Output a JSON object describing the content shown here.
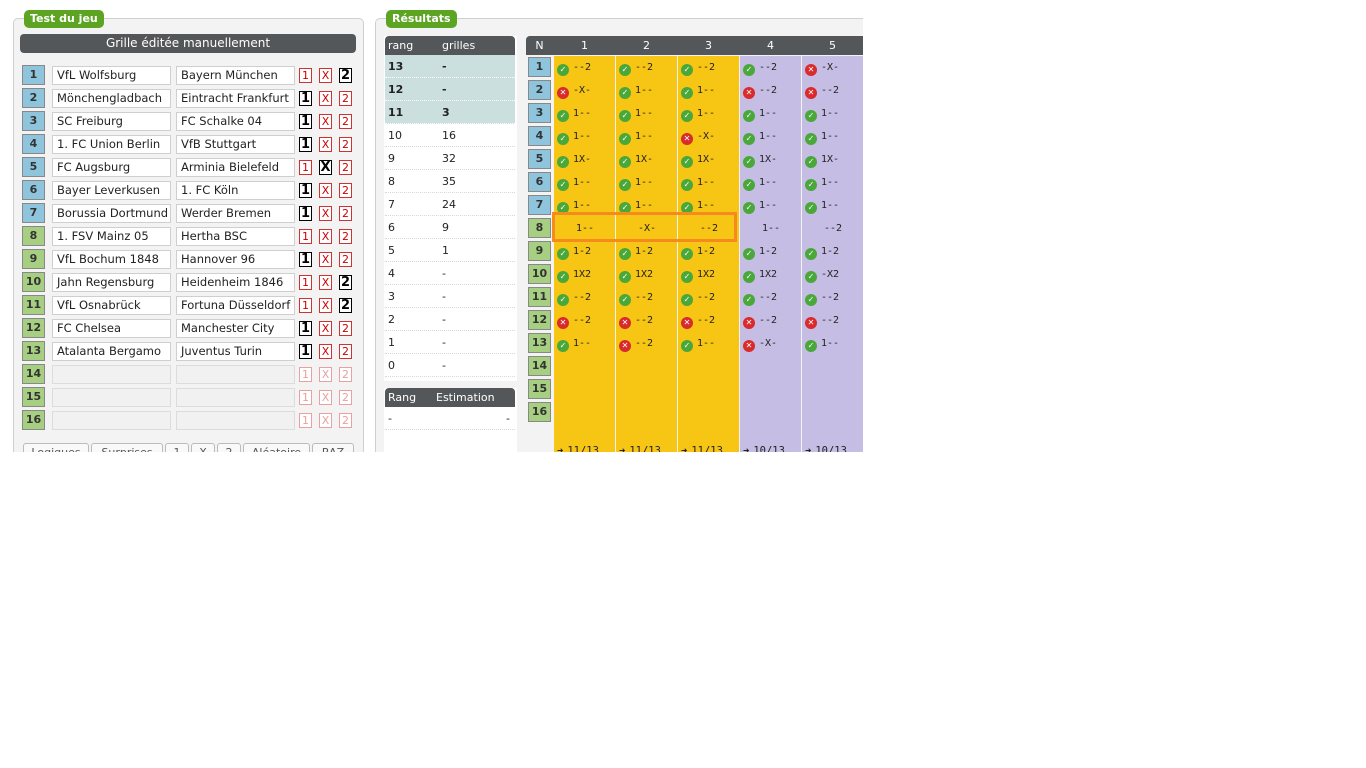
{
  "left_panel": {
    "title": "Test du jeu",
    "grid_title": "Grille éditée manuellement",
    "matches": [
      {
        "num": "1",
        "home": "VfL Wolfsburg",
        "away": "Bayern München",
        "pick": "2"
      },
      {
        "num": "2",
        "home": "Mönchengladbach",
        "away": "Eintracht Frankfurt",
        "pick": "1"
      },
      {
        "num": "3",
        "home": "SC Freiburg",
        "away": "FC Schalke 04",
        "pick": "1"
      },
      {
        "num": "4",
        "home": "1. FC Union Berlin",
        "away": "VfB Stuttgart",
        "pick": "1"
      },
      {
        "num": "5",
        "home": "FC Augsburg",
        "away": "Arminia Bielefeld",
        "pick": "X"
      },
      {
        "num": "6",
        "home": "Bayer Leverkusen",
        "away": "1. FC Köln",
        "pick": "1"
      },
      {
        "num": "7",
        "home": "Borussia Dortmund",
        "away": "Werder Bremen",
        "pick": "1"
      },
      {
        "num": "8",
        "home": "1. FSV Mainz 05",
        "away": "Hertha BSC",
        "pick": ""
      },
      {
        "num": "9",
        "home": "VfL Bochum 1848",
        "away": "Hannover 96",
        "pick": "1"
      },
      {
        "num": "10",
        "home": "Jahn Regensburg",
        "away": "Heidenheim 1846",
        "pick": "2"
      },
      {
        "num": "11",
        "home": "VfL Osnabrück",
        "away": "Fortuna Düsseldorf",
        "pick": "2"
      },
      {
        "num": "12",
        "home": "FC Chelsea",
        "away": "Manchester City",
        "pick": "1"
      },
      {
        "num": "13",
        "home": "Atalanta Bergamo",
        "away": "Juventus Turin",
        "pick": "1"
      },
      {
        "num": "14",
        "home": "",
        "away": "",
        "pick": ""
      },
      {
        "num": "15",
        "home": "",
        "away": "",
        "pick": ""
      },
      {
        "num": "16",
        "home": "",
        "away": "",
        "pick": ""
      }
    ],
    "pick_labels": [
      "1",
      "X",
      "2"
    ],
    "bottom_buttons": [
      "Logiques",
      "Surprises",
      "1",
      "X",
      "2",
      "Aléatoire",
      "RAZ"
    ]
  },
  "right_panel": {
    "title": "Résultats",
    "rank_table": {
      "headers": [
        "rang",
        "grilles"
      ],
      "rows": [
        {
          "rang": "13",
          "grilles": "-",
          "highlight": true
        },
        {
          "rang": "12",
          "grilles": "-",
          "highlight": true
        },
        {
          "rang": "11",
          "grilles": "3",
          "highlight": true
        },
        {
          "rang": "10",
          "grilles": "16",
          "highlight": false
        },
        {
          "rang": "9",
          "grilles": "32",
          "highlight": false
        },
        {
          "rang": "8",
          "grilles": "35",
          "highlight": false
        },
        {
          "rang": "7",
          "grilles": "24",
          "highlight": false
        },
        {
          "rang": "6",
          "grilles": "9",
          "highlight": false
        },
        {
          "rang": "5",
          "grilles": "1",
          "highlight": false
        },
        {
          "rang": "4",
          "grilles": "-",
          "highlight": false
        },
        {
          "rang": "3",
          "grilles": "-",
          "highlight": false
        },
        {
          "rang": "2",
          "grilles": "-",
          "highlight": false
        },
        {
          "rang": "1",
          "grilles": "-",
          "highlight": false
        },
        {
          "rang": "0",
          "grilles": "-",
          "highlight": false
        }
      ]
    },
    "estimation_table": {
      "headers": [
        "Rang",
        "Estimation"
      ],
      "rows": [
        {
          "rang": "-",
          "estimation": "-"
        }
      ]
    },
    "results_grid": {
      "header_n": "N",
      "columns": [
        "1",
        "2",
        "3",
        "4",
        "5"
      ],
      "column_colors": [
        "#f7c514",
        "#f7c514",
        "#f7c514",
        "#c5bde4",
        "#c5bde4"
      ],
      "row_numbers": [
        "1",
        "2",
        "3",
        "4",
        "5",
        "6",
        "7",
        "8",
        "9",
        "10",
        "11",
        "12",
        "13",
        "14",
        "15",
        "16"
      ],
      "rows": [
        [
          {
            "s": "ok",
            "v": "--2"
          },
          {
            "s": "ok",
            "v": "--2"
          },
          {
            "s": "ok",
            "v": "--2"
          },
          {
            "s": "ok",
            "v": "--2"
          },
          {
            "s": "ko",
            "v": "-X-"
          }
        ],
        [
          {
            "s": "ko",
            "v": "-X-"
          },
          {
            "s": "ok",
            "v": "1--"
          },
          {
            "s": "ok",
            "v": "1--"
          },
          {
            "s": "ko",
            "v": "--2"
          },
          {
            "s": "ko",
            "v": "--2"
          }
        ],
        [
          {
            "s": "ok",
            "v": "1--"
          },
          {
            "s": "ok",
            "v": "1--"
          },
          {
            "s": "ok",
            "v": "1--"
          },
          {
            "s": "ok",
            "v": "1--"
          },
          {
            "s": "ok",
            "v": "1--"
          }
        ],
        [
          {
            "s": "ok",
            "v": "1--"
          },
          {
            "s": "ok",
            "v": "1--"
          },
          {
            "s": "ko",
            "v": "-X-"
          },
          {
            "s": "ok",
            "v": "1--"
          },
          {
            "s": "ok",
            "v": "1--"
          }
        ],
        [
          {
            "s": "ok",
            "v": "1X-"
          },
          {
            "s": "ok",
            "v": "1X-"
          },
          {
            "s": "ok",
            "v": "1X-"
          },
          {
            "s": "ok",
            "v": "1X-"
          },
          {
            "s": "ok",
            "v": "1X-"
          }
        ],
        [
          {
            "s": "ok",
            "v": "1--"
          },
          {
            "s": "ok",
            "v": "1--"
          },
          {
            "s": "ok",
            "v": "1--"
          },
          {
            "s": "ok",
            "v": "1--"
          },
          {
            "s": "ok",
            "v": "1--"
          }
        ],
        [
          {
            "s": "ok",
            "v": "1--"
          },
          {
            "s": "ok",
            "v": "1--"
          },
          {
            "s": "ok",
            "v": "1--"
          },
          {
            "s": "ok",
            "v": "1--"
          },
          {
            "s": "ok",
            "v": "1--"
          }
        ],
        [
          {
            "s": "",
            "v": "1--"
          },
          {
            "s": "",
            "v": "-X-"
          },
          {
            "s": "",
            "v": "--2"
          },
          {
            "s": "",
            "v": "1--"
          },
          {
            "s": "",
            "v": "--2"
          }
        ],
        [
          {
            "s": "ok",
            "v": "1-2"
          },
          {
            "s": "ok",
            "v": "1-2"
          },
          {
            "s": "ok",
            "v": "1-2"
          },
          {
            "s": "ok",
            "v": "1-2"
          },
          {
            "s": "ok",
            "v": "1-2"
          }
        ],
        [
          {
            "s": "ok",
            "v": "1X2"
          },
          {
            "s": "ok",
            "v": "1X2"
          },
          {
            "s": "ok",
            "v": "1X2"
          },
          {
            "s": "ok",
            "v": "1X2"
          },
          {
            "s": "ok",
            "v": "-X2"
          }
        ],
        [
          {
            "s": "ok",
            "v": "--2"
          },
          {
            "s": "ok",
            "v": "--2"
          },
          {
            "s": "ok",
            "v": "--2"
          },
          {
            "s": "ok",
            "v": "--2"
          },
          {
            "s": "ok",
            "v": "--2"
          }
        ],
        [
          {
            "s": "ko",
            "v": "--2"
          },
          {
            "s": "ko",
            "v": "--2"
          },
          {
            "s": "ko",
            "v": "--2"
          },
          {
            "s": "ko",
            "v": "--2"
          },
          {
            "s": "ko",
            "v": "--2"
          }
        ],
        [
          {
            "s": "ok",
            "v": "1--"
          },
          {
            "s": "ko",
            "v": "--2"
          },
          {
            "s": "ok",
            "v": "1--"
          },
          {
            "s": "ko",
            "v": "-X-"
          },
          {
            "s": "ok",
            "v": "1--"
          }
        ]
      ],
      "totals": [
        "11/13",
        "11/13",
        "11/13",
        "10/13",
        "10/13"
      ],
      "total_arrow": "➜"
    }
  },
  "colors": {
    "accent_green": "#5da423",
    "header_dark": "#545759",
    "highlight_orange": "#f58a1f",
    "ok_green": "#4aa83a",
    "ko_red": "#d92b2b"
  },
  "icons": {
    "ok": "check-circle-icon",
    "ko": "cross-circle-icon",
    "arrow": "arrow-right-icon"
  }
}
